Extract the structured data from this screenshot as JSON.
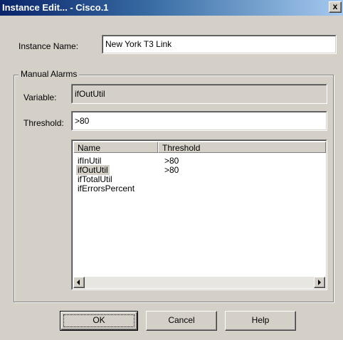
{
  "window": {
    "title": "Instance Edit... - Cisco.1",
    "close_glyph": "x"
  },
  "instance_name": {
    "label": "Instance Name:",
    "value": "New York T3 Link"
  },
  "manual_alarms": {
    "group_title": "Manual Alarms",
    "variable_label": "Variable:",
    "variable_value": "ifOutUtil",
    "threshold_label": "Threshold:",
    "threshold_value": ">80",
    "list": {
      "columns": [
        "Name",
        "Threshold"
      ],
      "rows": [
        {
          "name": "ifInUtil",
          "threshold": ">80",
          "selected": false
        },
        {
          "name": "ifOutUtil",
          "threshold": ">80",
          "selected": true
        },
        {
          "name": "ifTotalUtil",
          "threshold": "",
          "selected": false
        },
        {
          "name": "ifErrorsPercent",
          "threshold": "",
          "selected": false
        }
      ]
    }
  },
  "buttons": {
    "ok": "OK",
    "cancel": "Cancel",
    "help": "Help"
  },
  "colors": {
    "title_start": "#0a246a",
    "title_end": "#a6caf0",
    "face": "#d4d0c8"
  },
  "icons": {
    "scroll_left": "arrow-left-icon",
    "scroll_right": "arrow-right-icon"
  }
}
